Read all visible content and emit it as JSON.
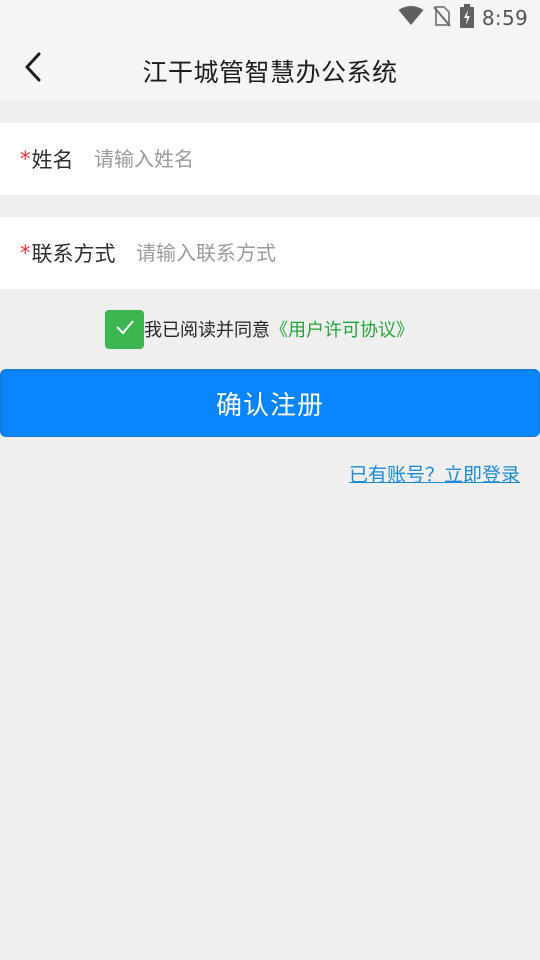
{
  "status_bar": {
    "time": "8:59",
    "icons": [
      "wifi-icon",
      "no-sim-icon",
      "battery-charging-icon"
    ]
  },
  "app_bar": {
    "title": "江干城管智慧办公系统",
    "back_icon": "chevron-left-icon"
  },
  "form": {
    "name": {
      "required_mark": "*",
      "label": "姓名",
      "placeholder": "请输入姓名",
      "value": ""
    },
    "contact": {
      "required_mark": "*",
      "label": "联系方式",
      "placeholder": "请输入联系方式",
      "value": ""
    }
  },
  "agreement": {
    "checked": true,
    "text": "我已阅读并同意",
    "link": "《用户许可协议》"
  },
  "register_button": {
    "label": "确认注册"
  },
  "login_link": {
    "label": "已有账号？立即登录"
  },
  "colors": {
    "primary": "#0a84fb",
    "checkbox": "#3cb64f",
    "agreement_link": "#23a43a",
    "login_link": "#1a8ad8",
    "required": "#e53935",
    "background": "#efefef"
  }
}
